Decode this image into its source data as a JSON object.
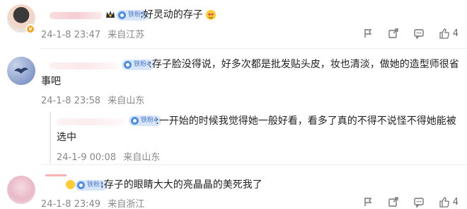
{
  "comments": [
    {
      "badge": "铁粉3",
      "text": ":好灵动的存子",
      "time": "24-1-8 23:47",
      "location": "来自江苏",
      "likes": "4"
    },
    {
      "badge": "铁粉4",
      "text_line1": ":存子脸没得说，好多次都是批发贴头皮，妆也清淡，做她的造型师很省",
      "text_line2": "事吧",
      "time": "24-1-8 23:58",
      "location": "来自山东"
    },
    {
      "badge": "铁粉4",
      "text_line1": ":一开始的时候我觉得她一般好看，看多了真的不得不说怪不得她能被",
      "text_line2": "选中",
      "time": "24-1-9 00:08",
      "location": "来自山东"
    },
    {
      "badge": "铁粉1",
      "text": ":存子的眼睛大大的亮晶晶的美死我了",
      "time": "24-1-8 23:49",
      "location": "来自浙江",
      "likes": "4"
    }
  ],
  "icons": {
    "report": "report-icon",
    "share": "share-icon",
    "comment": "comment-icon",
    "like": "thumbs-up-icon"
  },
  "colors": {
    "badge_bg": "#d8e6fb",
    "badge_text": "#4a78c9",
    "meta_text": "#888888"
  }
}
